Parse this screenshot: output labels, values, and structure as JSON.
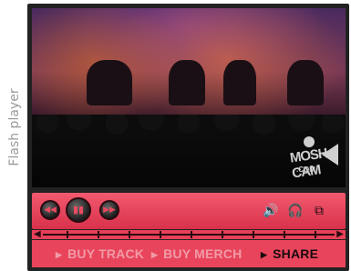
{
  "side_label": "Flash player",
  "logo": {
    "line1": "MOSH CAM",
    "line2": ".COM"
  },
  "controls": {
    "rewind_icon": "rewind-icon",
    "play_pause_icon": "pause-icon",
    "forward_icon": "fast-forward-icon",
    "volume_icon": "volume-icon",
    "headphones_icon": "headphones-icon",
    "fullscreen_icon": "fullscreen-icon"
  },
  "links": {
    "buy_track": "BUY TRACK",
    "buy_merch": "BUY MERCH",
    "share": "SHARE"
  },
  "colors": {
    "panel": "#e8455c",
    "active_link": "#1a0a0e",
    "inactive_link": "#f29aa7"
  }
}
